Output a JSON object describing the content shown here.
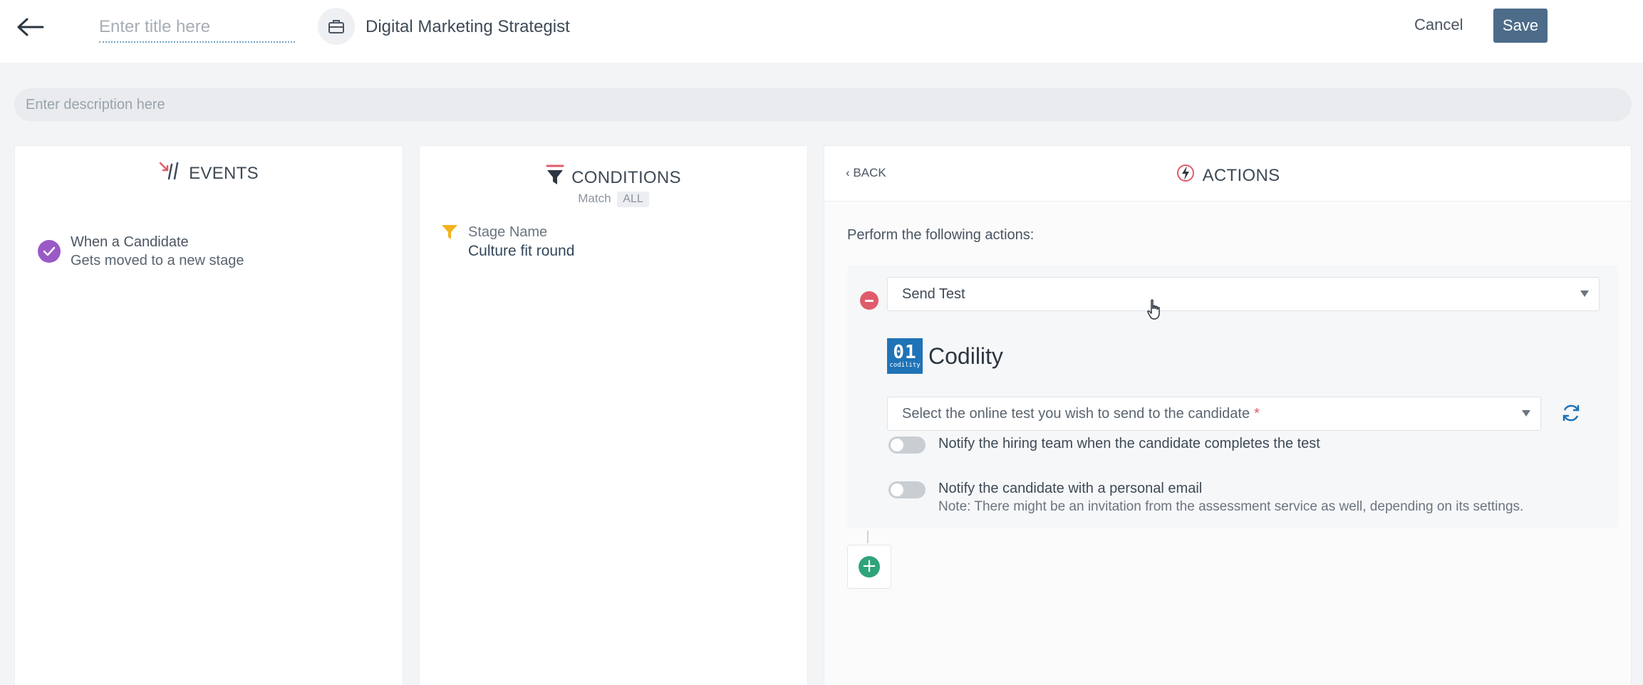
{
  "header": {
    "title_placeholder": "Enter title here",
    "job_title": "Digital Marketing Strategist",
    "cancel_label": "Cancel",
    "save_label": "Save",
    "icons": {
      "back": "arrow-left-icon",
      "job": "briefcase-icon"
    }
  },
  "description": {
    "placeholder": "Enter description here"
  },
  "events": {
    "heading": "EVENTS",
    "icon": "events-icon",
    "items": [
      {
        "line1": "When a Candidate",
        "line2": "Gets moved to a new stage",
        "icon": "check-circle-icon"
      }
    ]
  },
  "conditions": {
    "heading": "CONDITIONS",
    "icon": "funnel-icon",
    "match_label": "Match",
    "match_value": "ALL",
    "items": [
      {
        "label": "Stage Name",
        "value": "Culture fit round",
        "icon": "filter-icon"
      }
    ]
  },
  "actions": {
    "heading": "ACTIONS",
    "icon": "lightning-icon",
    "back_label": "BACK",
    "perform_text": "Perform the following actions:",
    "action_select_value": "Send Test",
    "provider_name": "Codility",
    "provider_logo_top": "01",
    "provider_logo_bottom": "codility",
    "test_select_placeholder": "Select the online test you wish to send to the candidate",
    "required_mark": "*",
    "toggle_notify_team": "Notify the hiring team when the candidate completes the test",
    "toggle_notify_candidate": "Notify the candidate with a personal email",
    "note": "Note: There might be an invitation from the assessment service as well, depending on its settings.",
    "add_label": "+"
  },
  "colors": {
    "accent": "#4d6c8a",
    "events_check": "#9b59c6",
    "remove": "#e05b6b",
    "add": "#2fa37a",
    "codility_blue": "#1f73b7",
    "funnel_yellow": "#f5b21b"
  }
}
